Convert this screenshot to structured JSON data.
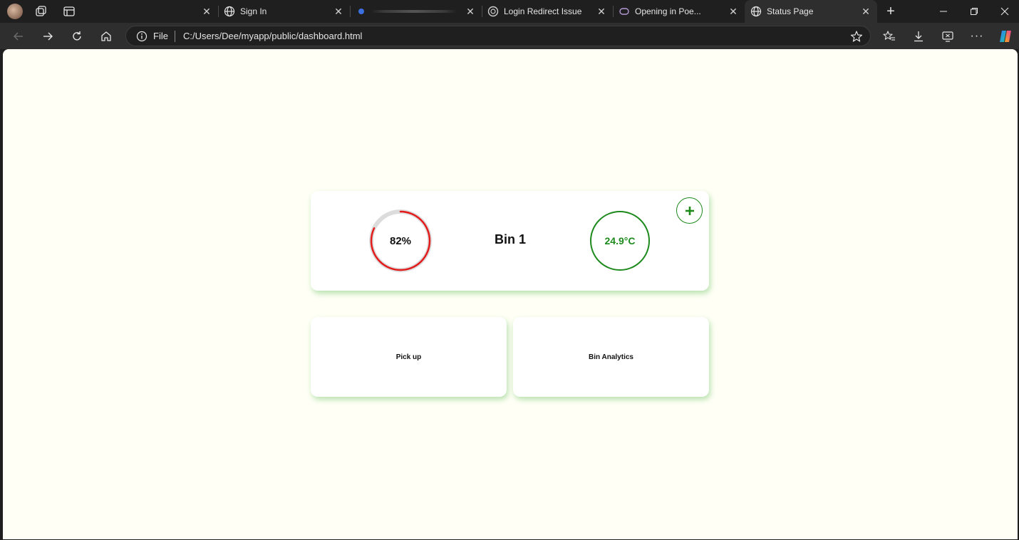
{
  "browser": {
    "tabs": [
      {
        "title": "",
        "favicon": "blurred-favicon",
        "active": false
      },
      {
        "title": "Sign In",
        "favicon": "globe-icon",
        "active": false
      },
      {
        "title": "",
        "favicon": "blurred-favicon",
        "active": false
      },
      {
        "title": "Login Redirect Issue",
        "favicon": "chatgpt-icon",
        "active": false
      },
      {
        "title": "Opening in Poe...",
        "favicon": "poe-icon",
        "active": false
      },
      {
        "title": "Status Page",
        "favicon": "globe-icon",
        "active": true
      }
    ],
    "address": {
      "scheme_label": "File",
      "url": "C:/Users/Dee/myapp/public/dashboard.html"
    }
  },
  "page": {
    "bin": {
      "name": "Bin 1",
      "fill_level_label": "82%",
      "fill_level": 0.82,
      "temperature_label": "24.9°C",
      "fill_color": "#e31b1b",
      "temperature_color": "#1e8a1e"
    },
    "actions": {
      "pickup_label": "Pick up",
      "analytics_label": "Bin Analytics"
    },
    "colors": {
      "page_background": "#fffff6",
      "card_shadow": "#64be5a"
    }
  }
}
